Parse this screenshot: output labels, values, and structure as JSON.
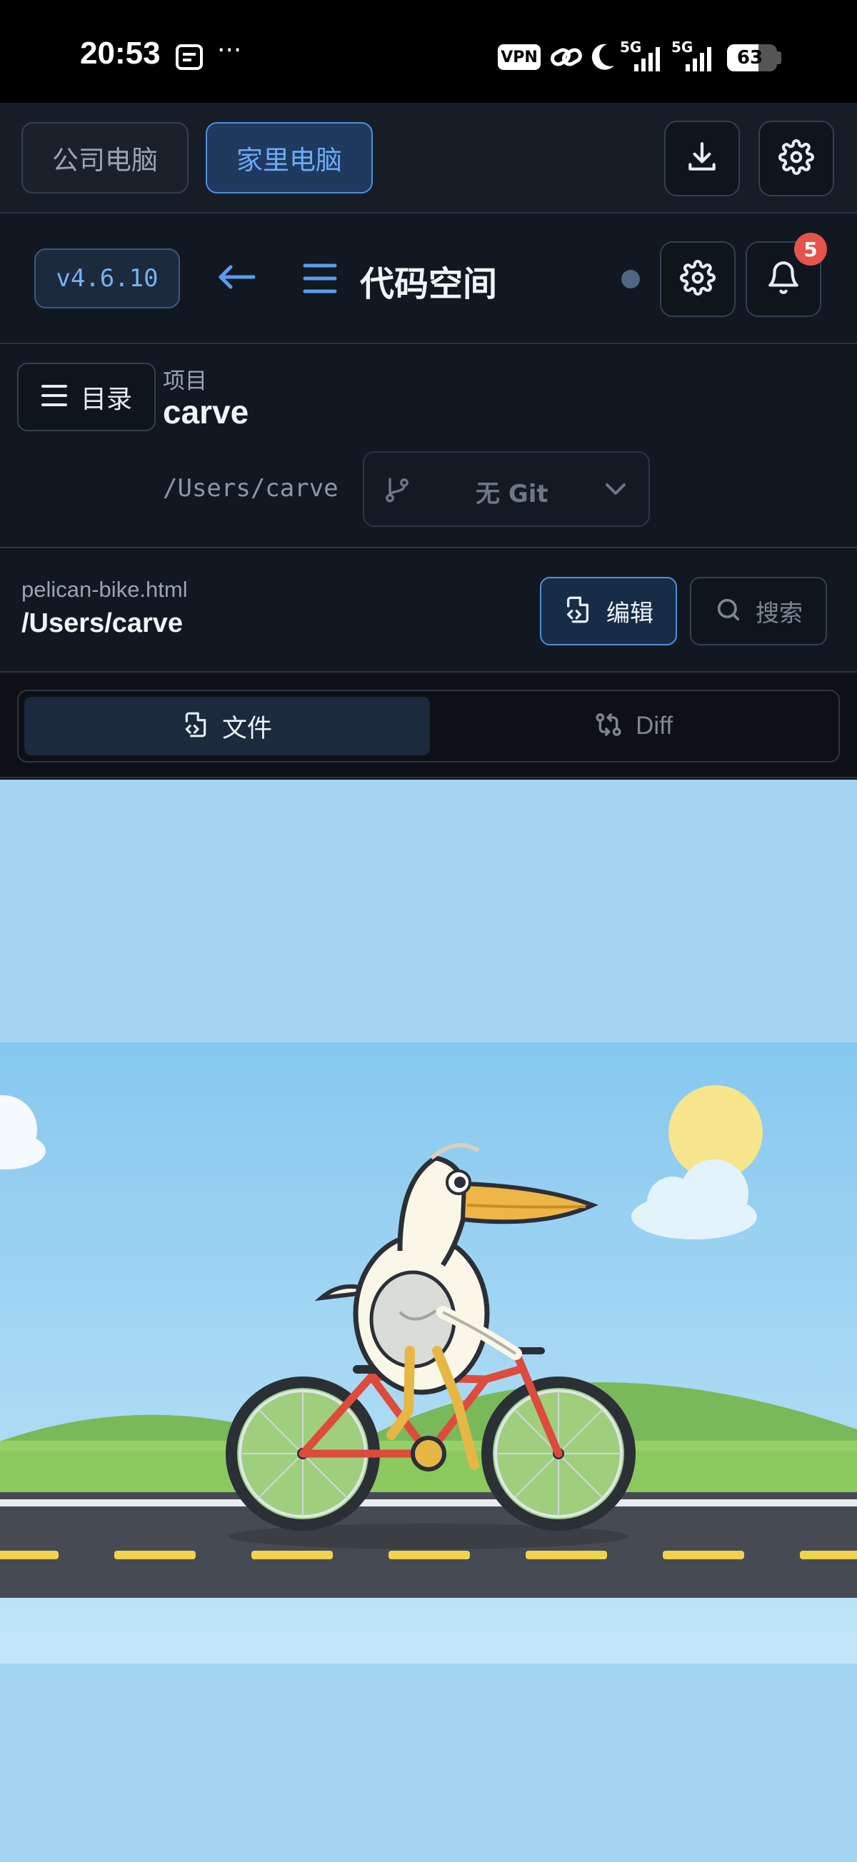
{
  "status_bar": {
    "time": "20:53",
    "vpn": "VPN",
    "signal_1": "5G",
    "signal_2": "5G",
    "battery": "63"
  },
  "machine_tabs": [
    {
      "label": "公司电脑",
      "active": false
    },
    {
      "label": "家里电脑",
      "active": true
    }
  ],
  "header": {
    "version": "v4.6.10",
    "title": "代码空间",
    "notification_count": "5"
  },
  "project": {
    "toc_label": "目录",
    "section_label": "项目",
    "name": "carve",
    "path": "/Users/carve",
    "git_label": "无 Git"
  },
  "file": {
    "name": "pelican-bike.html",
    "path": "/Users/carve",
    "edit_label": "编辑",
    "search_placeholder": "搜索"
  },
  "view_tabs": [
    {
      "label": "文件",
      "active": true
    },
    {
      "label": "Diff",
      "active": false
    }
  ],
  "colors": {
    "accent": "#5b9cf0",
    "active_pill_bg": "#1e3a5f",
    "badge": "#e5534b",
    "sky": "#a3d5f2",
    "road": "#464b53",
    "grass": "#79b95a",
    "sun": "#f7e58b"
  },
  "icons": {
    "download": "download-icon",
    "settings": "gear-icon",
    "back": "arrow-left-icon",
    "menu": "menu-icon",
    "bell": "bell-icon",
    "branch": "git-branch-icon",
    "file_code": "file-code-icon",
    "search": "search-icon",
    "diff": "diff-icon"
  }
}
